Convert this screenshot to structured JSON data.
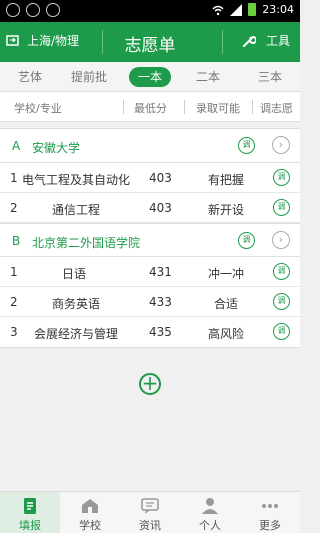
{
  "status_bar": {
    "time": "23:04"
  },
  "header": {
    "location": "上海/物理",
    "title": "志愿单",
    "tools_label": "工具"
  },
  "tabs": [
    "艺体",
    "提前批",
    "一本",
    "二本",
    "三本"
  ],
  "columns": [
    "学校/专业",
    "最低分",
    "录取可能",
    "调志愿"
  ],
  "universities": [
    {
      "letter": "A",
      "name": "安徽大学",
      "majors": [
        {
          "no": "1",
          "name": "电气工程及其自动化",
          "score": "403",
          "chance": "有把握"
        },
        {
          "no": "2",
          "name": "通信工程",
          "score": "403",
          "chance": "新开设"
        }
      ]
    },
    {
      "letter": "B",
      "name": "北京第二外国语学院",
      "majors": [
        {
          "no": "1",
          "name": "日语",
          "score": "431",
          "chance": "冲一冲"
        },
        {
          "no": "2",
          "name": "商务英语",
          "score": "433",
          "chance": "合适"
        },
        {
          "no": "3",
          "name": "会展经济与管理",
          "score": "435",
          "chance": "高风险"
        }
      ]
    }
  ],
  "adjust_badge": "调",
  "add_symbol": "+",
  "bottom_nav": [
    "填报",
    "学校",
    "资讯",
    "个人",
    "更多"
  ],
  "colors": {
    "brand": "#1e9b4a"
  }
}
